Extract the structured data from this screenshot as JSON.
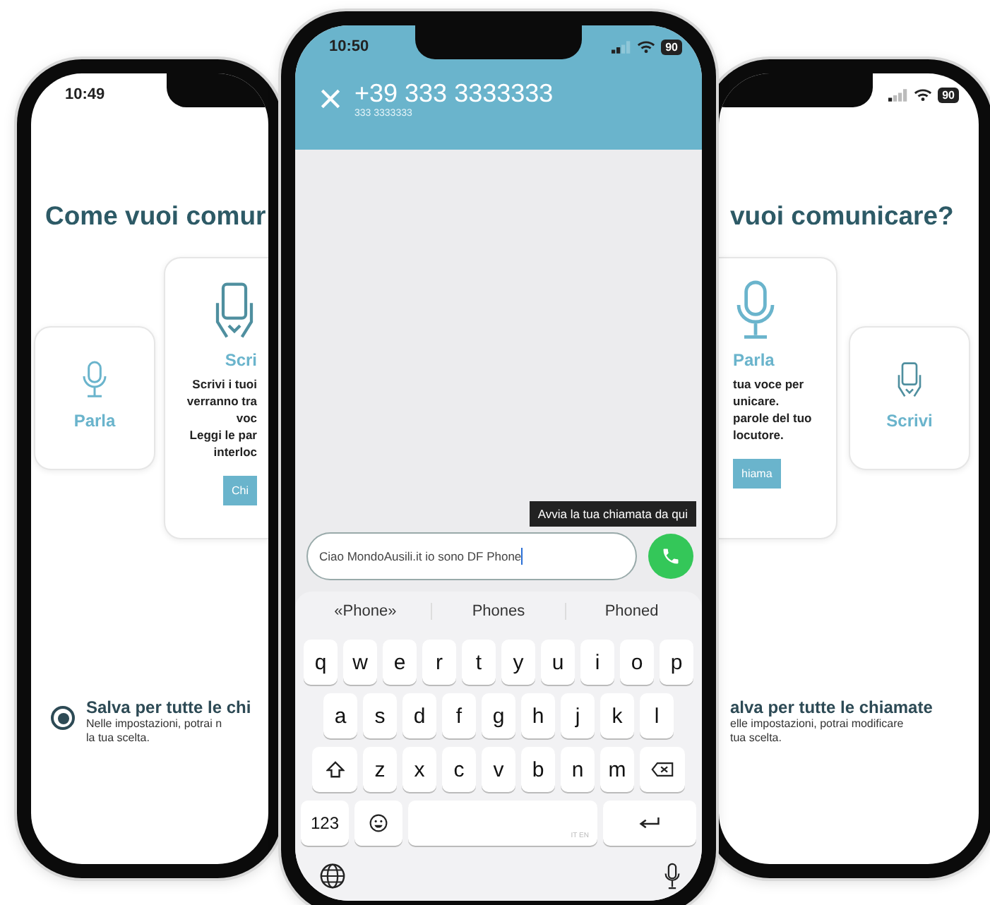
{
  "phones": [
    {
      "kind": "chooser",
      "status": {
        "time": "10:49"
      },
      "title": "Come vuoi comur",
      "cards": [
        {
          "kind": "compact",
          "label": "Parla"
        },
        {
          "kind": "expanded",
          "label": "Scri",
          "lines": [
            "Scrivi i tuoi",
            "verranno tra",
            "voc",
            "Leggi le par",
            "interloc"
          ],
          "button": "Chi"
        }
      ],
      "save": {
        "selected": true,
        "title": "Salva per tutte le chi",
        "lines": [
          "Nelle impostazioni, potrai n",
          "la tua scelta."
        ]
      }
    },
    {
      "kind": "chooser",
      "status": {
        "battery": "90"
      },
      "title": "vuoi comunicare?",
      "cards": [
        {
          "kind": "expanded",
          "label": "Parla",
          "lines": [
            "tua voce per",
            "unicare.",
            "parole del tuo",
            "locutore."
          ],
          "button": "hiama"
        },
        {
          "kind": "compact",
          "label": "Scrivi"
        }
      ],
      "save": {
        "title": "alva per tutte le chiamate",
        "lines": [
          "elle impostazioni, potrai modificare",
          "tua scelta."
        ]
      }
    },
    {
      "kind": "caller",
      "status": {
        "time": "10:50",
        "battery": "90"
      },
      "number": "+39 333 3333333",
      "subtitle": "333 3333333",
      "tooltip": "Avvia la tua chiamata da qui",
      "message": "Ciao MondoAusili.it io sono DF Phone",
      "keyboard": {
        "suggestions": [
          "«Phone»",
          "Phones",
          "Phoned"
        ],
        "letter_rows": [
          [
            "q",
            "w",
            "e",
            "r",
            "t",
            "y",
            "u",
            "i",
            "o",
            "p"
          ],
          [
            "a",
            "s",
            "d",
            "f",
            "g",
            "h",
            "j",
            "k",
            "l"
          ],
          [
            "z",
            "x",
            "c",
            "v",
            "b",
            "n",
            "m"
          ]
        ],
        "numbers_key": "123",
        "space_label": "IT EN"
      }
    }
  ]
}
